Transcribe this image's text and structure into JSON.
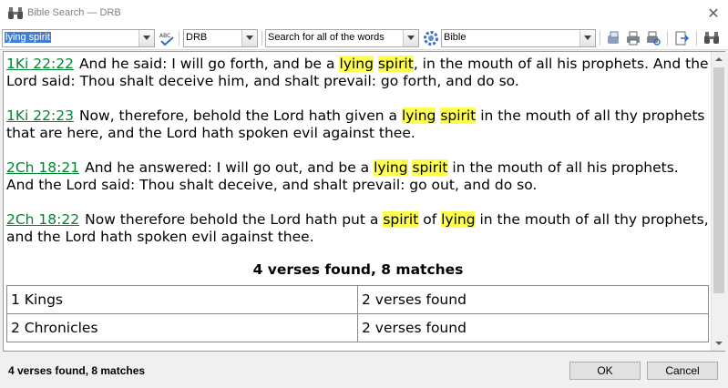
{
  "window": {
    "title": "Bible Search — DRB",
    "close_glyph": "✕"
  },
  "toolbar": {
    "search_value": "lying spirit",
    "version_value": "DRB",
    "mode_value": "Search for all of the words",
    "scope_value": "Bible",
    "icons": [
      "binoculars-icon",
      "spellcheck-icon",
      "gear-icon",
      "copy-icon",
      "print-icon",
      "print-preview-icon",
      "export-icon",
      "find-icon"
    ]
  },
  "results": {
    "verses": [
      {
        "ref": "1Ki 22:22",
        "parts": [
          "And he said: I will go forth, and be a ",
          "lying",
          " ",
          "spirit",
          ", in the mouth of all his prophets. And the Lord said: Thou shalt deceive him, and shalt prevail: go forth, and do so."
        ]
      },
      {
        "ref": "1Ki 22:23",
        "parts": [
          "Now, therefore, behold the Lord hath given a ",
          "lying",
          " ",
          "spirit",
          " in the mouth of all thy prophets that are here, and the Lord hath spoken evil against thee."
        ]
      },
      {
        "ref": "2Ch 18:21",
        "parts": [
          "And he answered: I will go out, and be a ",
          "lying",
          " ",
          "spirit",
          " in the mouth of all his prophets. And the Lord said: Thou shalt deceive, and shalt prevail: go out, and do so."
        ]
      },
      {
        "ref": "2Ch 18:22",
        "parts": [
          "Now therefore behold the Lord hath put a ",
          "spirit",
          " of ",
          "lying",
          " in the mouth of all thy prophets, and the Lord hath spoken evil against thee."
        ]
      }
    ],
    "summary": "4 verses found, 8 matches",
    "books_table": [
      {
        "book": "1 Kings",
        "count": "2 verses found"
      },
      {
        "book": "2 Chronicles",
        "count": "2 verses found"
      }
    ]
  },
  "status": {
    "text": "4 verses found, 8 matches"
  },
  "buttons": {
    "ok": "OK",
    "cancel": "Cancel"
  },
  "colors": {
    "highlight": "#ffff50",
    "reference_link": "#00852e",
    "selection": "#3f7fd7"
  }
}
